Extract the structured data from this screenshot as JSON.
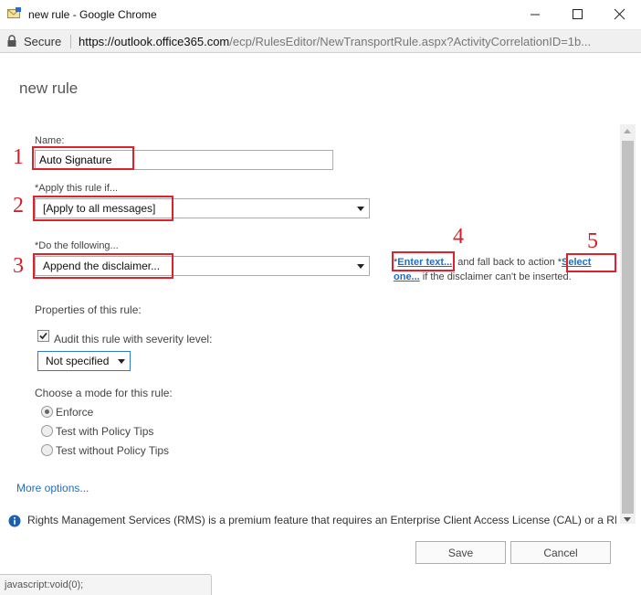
{
  "window": {
    "title": "new rule - Google Chrome"
  },
  "address_bar": {
    "secure_label": "Secure",
    "url_scheme": "https://",
    "url_host": "outlook.office365.com",
    "url_path": "/ecp/RulesEditor/NewTransportRule.aspx?ActivityCorrelationID=1b..."
  },
  "page": {
    "title": "new rule"
  },
  "form": {
    "name_label": "Name:",
    "name_value": "Auto Signature",
    "apply_label": "*Apply this rule if...",
    "apply_value": "[Apply to all messages]",
    "do_label": "*Do the following...",
    "do_value": "Append the disclaimer...",
    "action_prefix": "*",
    "action_link_enter": "Enter text...",
    "action_mid": "; and fall back to action *",
    "action_link_select": "Select one...",
    "action_suffix": " if the disclaimer can't be inserted.",
    "properties_label": "Properties of this rule:",
    "audit_label": "Audit this rule with severity level:",
    "audit_checked": true,
    "severity_value": "Not specified",
    "mode_label": "Choose a mode for this rule:",
    "modes": [
      {
        "label": "Enforce",
        "selected": true
      },
      {
        "label": "Test with Policy Tips",
        "selected": false
      },
      {
        "label": "Test without Policy Tips",
        "selected": false
      }
    ],
    "more_options": "More options..."
  },
  "annotations": [
    "1",
    "2",
    "3",
    "4",
    "5"
  ],
  "notice": {
    "rms_text": "Rights Management Services (RMS) is a premium feature that requires an Enterprise Client Access License (CAL) or a RMS"
  },
  "buttons": {
    "save": "Save",
    "cancel": "Cancel"
  },
  "status": {
    "text": "javascript:void(0);"
  },
  "colors": {
    "annotation_red": "#e0202a",
    "link_blue": "#1f6fbf"
  }
}
